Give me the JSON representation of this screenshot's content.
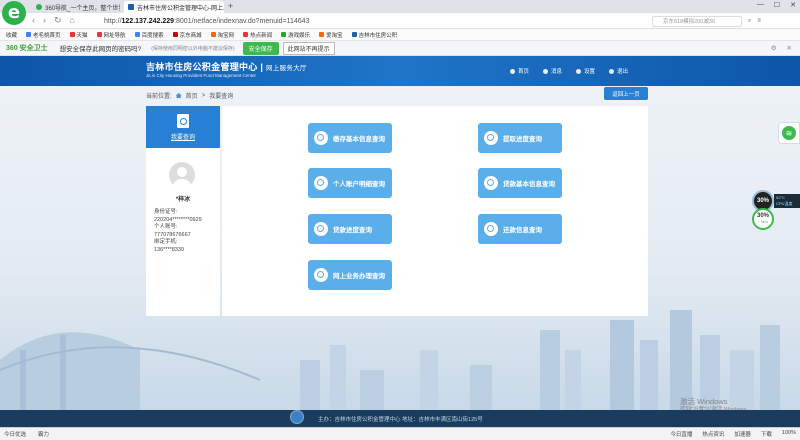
{
  "browser": {
    "tabs": [
      {
        "title": "360导航_一个主页，整个世界",
        "active": false
      },
      {
        "title": "吉林市住房公积金管理中心-网上...",
        "active": true
      }
    ],
    "new_tab": "+",
    "url_scheme": "http://",
    "url_host": "122.137.242.229",
    "url_path": ":8001/netface/indexnav.do?menuid=114643",
    "search_placeholder": "京东618模拟200减30",
    "win_controls": [
      "—",
      "☐",
      "✕"
    ],
    "bookmarks": [
      "收藏",
      "老毛桃首页",
      "天猫",
      "网址导航",
      "百度搜索",
      "京东商城",
      "淘宝网",
      "热点新闻",
      "游戏娱乐",
      "爱淘宝",
      "吉林市住房公积"
    ]
  },
  "notice": {
    "brand": "360 安全卫士",
    "question": "想安全保存此网页的密码吗?",
    "tip": "(保存使用同明密以外电脑不建议保存)",
    "save_label": "安全保存",
    "nosave_label": "此网站不再提示"
  },
  "site": {
    "title": "吉林市住房公积金管理中心",
    "subtitle": "网上服务大厅",
    "title_en": "JiLin City Housing Provident Fund Management Center",
    "nav": [
      "首页",
      "消息",
      "设置",
      "退出"
    ]
  },
  "crumb": {
    "label": "当前位置:",
    "home": "首页",
    "current": "我要查询",
    "back": "返回上一页"
  },
  "sidebar": {
    "heading": "我要查询",
    "username": "*梓冰",
    "id_label": "身份证号:",
    "id_value": "220204********0929",
    "account_label": "个人账号:",
    "account_value": "777078676667",
    "phone_label": "绑定手机:",
    "phone_value": "136****8339"
  },
  "buttons": [
    {
      "label": "缴存基本信息查询"
    },
    {
      "label": "提取进度查询"
    },
    {
      "label": "个人账户明细查询"
    },
    {
      "label": "贷款基本信息查询"
    },
    {
      "label": "贷款进度查询"
    },
    {
      "label": "还款信息查询"
    },
    {
      "label": "网上业务办理查询"
    }
  ],
  "widgets": {
    "gauge1": "30%",
    "cpu_line1": "52°C",
    "cpu_line2": "CPU温度",
    "gauge2": "30%",
    "gauge2_sub": "↑ 9K/s"
  },
  "watermark": {
    "line1": "激活 Windows",
    "line2": "转到\"设置\"以激活 Windows。"
  },
  "footer": {
    "text": "主办：吉林市住房公积金管理中心  地址：吉林市丰满区南山街125号"
  },
  "statusbar": {
    "left": [
      "今日优选",
      "霸力"
    ],
    "right": [
      "今日直播",
      "热点资讯",
      "加速器",
      "下载",
      "100%"
    ]
  }
}
